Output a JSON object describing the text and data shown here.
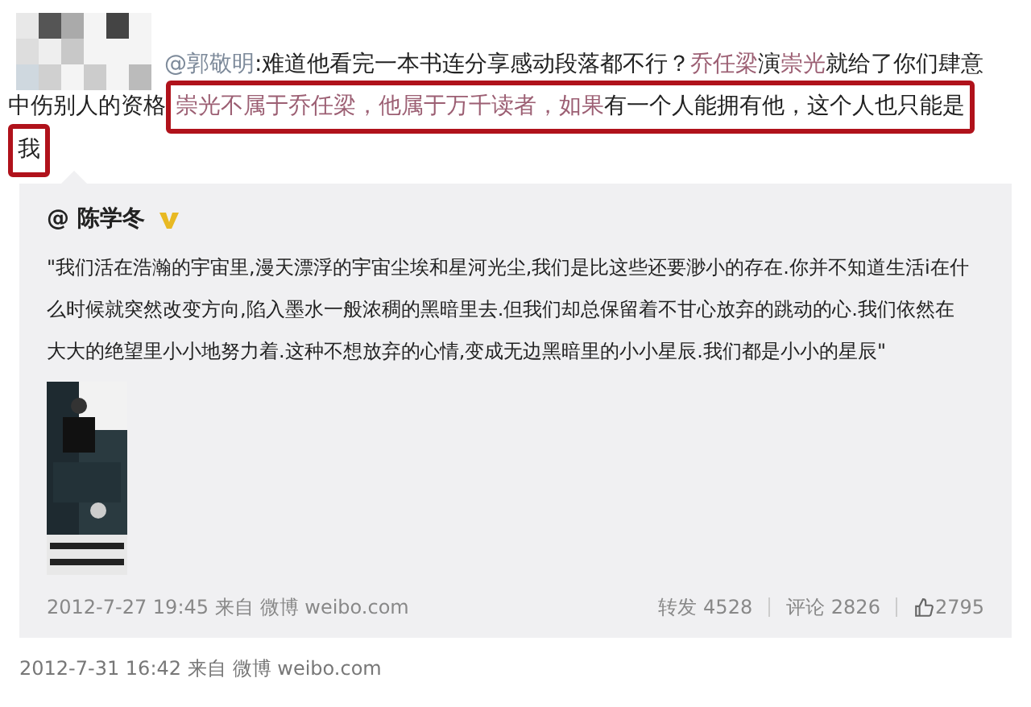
{
  "post": {
    "lines": [
      [
        {
          "kind": "mention",
          "text": "@郭敬明"
        },
        {
          "kind": "plain",
          "text": ":难道他看完一本书连分享感动段落都不行？"
        },
        {
          "kind": "name",
          "text": "乔任梁"
        },
        {
          "kind": "plain",
          "text": "演"
        },
        {
          "kind": "name",
          "text": "崇光"
        },
        {
          "kind": "plain",
          "text": "就给了你们肆意"
        }
      ],
      [
        {
          "kind": "plain",
          "text": "中伤别人的资格"
        },
        {
          "kind": "box",
          "children": [
            {
              "kind": "name",
              "text": "崇光不属于乔任梁，他属于万千读者，如果"
            },
            {
              "kind": "plain",
              "text": "有一个人能拥有他，这个人也只能是"
            }
          ]
        }
      ],
      [
        {
          "kind": "box",
          "children": [
            {
              "kind": "plain",
              "text": "我"
            }
          ]
        }
      ]
    ],
    "footer": {
      "time": "2012-7-31 16:42",
      "source": "来自 微博 weibo.com"
    }
  },
  "repost": {
    "author": "@ 陈学冬",
    "verified": true,
    "quote_lines": [
      "\"我们活在浩瀚的宇宙里,漫天漂浮的宇宙尘埃和星河光尘,我们是比这些还要渺小的存在.你并不知道生活i在什",
      "么时候就突然改变方向,陷入墨水一般浓稠的黑暗里去.但我们却总保留着不甘心放弃的跳动的心.我们依然在",
      "大大的绝望里小小地努力着.这种不想放弃的心情,变成无边黑暗里的小小星辰.我们都是小小的星辰\""
    ],
    "time": "2012-7-27 19:45",
    "source": "来自 微博 weibo.com",
    "reposts": "转发 4528",
    "comments": "评论 2826",
    "likes": "2795"
  }
}
